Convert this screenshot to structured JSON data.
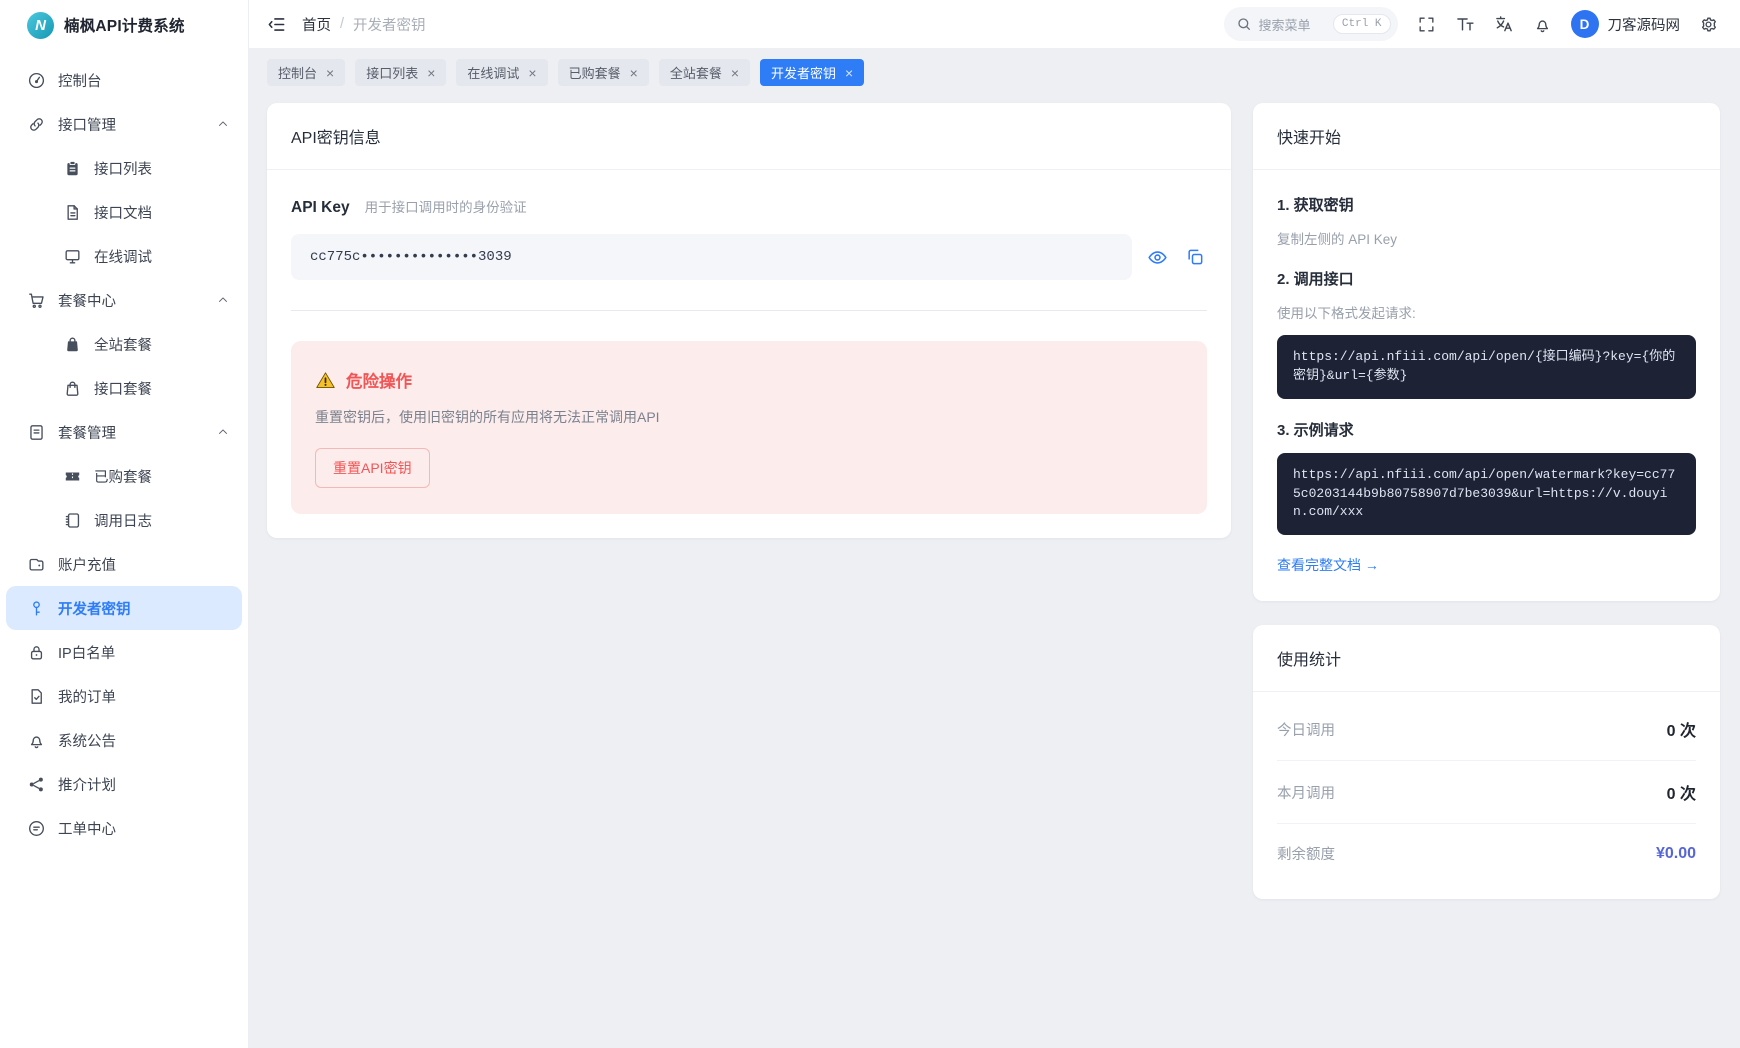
{
  "app": {
    "title": "楠枫API计费系统",
    "logo_letter": "N",
    "logo_icon": "logo-icon"
  },
  "colors": {
    "primary": "#2e7cf6",
    "sidebar_active_bg": "#dbeafe",
    "page_bg": "#edeff3",
    "danger_text": "#f25555",
    "danger_bg": "#fdecec",
    "code_bg": "#1d2335",
    "balance_value": "#5566d6",
    "avatar_bg": "#2e73f2"
  },
  "sidebar": {
    "items": [
      {
        "key": "dashboard",
        "label": "控制台",
        "icon": "dashboard-icon"
      },
      {
        "key": "api-management",
        "label": "接口管理",
        "icon": "api-link-icon",
        "expanded": true,
        "children": [
          {
            "key": "api-list",
            "label": "接口列表",
            "icon": "clipboard-icon"
          },
          {
            "key": "api-docs",
            "label": "接口文档",
            "icon": "file-text-icon"
          },
          {
            "key": "online-debug",
            "label": "在线调试",
            "icon": "monitor-icon"
          }
        ]
      },
      {
        "key": "package-center",
        "label": "套餐中心",
        "icon": "cart-icon",
        "expanded": true,
        "children": [
          {
            "key": "site-packages",
            "label": "全站套餐",
            "icon": "bag-filled-icon"
          },
          {
            "key": "api-packages",
            "label": "接口套餐",
            "icon": "bag-outline-icon"
          }
        ]
      },
      {
        "key": "package-management",
        "label": "套餐管理",
        "icon": "document-lines-icon",
        "expanded": true,
        "children": [
          {
            "key": "purchased-packages",
            "label": "已购套餐",
            "icon": "ticket-icon"
          },
          {
            "key": "call-logs",
            "label": "调用日志",
            "icon": "notebook-icon"
          }
        ]
      },
      {
        "key": "account-recharge",
        "label": "账户充值",
        "icon": "wallet-icon"
      },
      {
        "key": "developer-key",
        "label": "开发者密钥",
        "icon": "key-icon",
        "active": true
      },
      {
        "key": "ip-whitelist",
        "label": "IP白名单",
        "icon": "lock-icon"
      },
      {
        "key": "my-orders",
        "label": "我的订单",
        "icon": "file-check-icon"
      },
      {
        "key": "system-announcements",
        "label": "系统公告",
        "icon": "bell-icon"
      },
      {
        "key": "referral-program",
        "label": "推介计划",
        "icon": "share-icon"
      },
      {
        "key": "ticket-center",
        "label": "工单中心",
        "icon": "chat-circle-icon"
      }
    ]
  },
  "header": {
    "collapse_icon": "collapse-sidebar-icon",
    "breadcrumb": {
      "home": "首页",
      "separator": "/",
      "current": "开发者密钥"
    },
    "search": {
      "icon": "search-icon",
      "placeholder": "搜索菜单",
      "shortcut": "Ctrl K"
    },
    "tools": [
      {
        "key": "fullscreen",
        "icon": "fullscreen-icon"
      },
      {
        "key": "font-size",
        "icon": "font-size-icon"
      },
      {
        "key": "translate",
        "icon": "translate-icon"
      },
      {
        "key": "notifications",
        "icon": "bell-icon"
      }
    ],
    "user": {
      "initial": "D",
      "name": "刀客源码网"
    },
    "settings_icon": "gear-icon"
  },
  "tabs": [
    {
      "key": "dashboard",
      "label": "控制台"
    },
    {
      "key": "api-list",
      "label": "接口列表"
    },
    {
      "key": "online-debug",
      "label": "在线调试"
    },
    {
      "key": "purchased-packages",
      "label": "已购套餐"
    },
    {
      "key": "site-packages",
      "label": "全站套餐"
    },
    {
      "key": "developer-key",
      "label": "开发者密钥",
      "active": true
    }
  ],
  "tab_close_glyph": "×",
  "main": {
    "card_title": "API密钥信息",
    "api_key": {
      "label": "API Key",
      "hint": "用于接口调用时的身份验证",
      "value": "cc775c••••••••••••••3039",
      "actions": [
        "eye-icon",
        "copy-icon"
      ]
    },
    "danger": {
      "warning_icon": "warning-triangle-icon",
      "title": "危险操作",
      "desc": "重置密钥后，使用旧密钥的所有应用将无法正常调用API",
      "button": "重置API密钥"
    }
  },
  "quick_start": {
    "title": "快速开始",
    "steps": [
      {
        "title": "1. 获取密钥",
        "desc": "复制左侧的 API Key"
      },
      {
        "title": "2. 调用接口",
        "desc": "使用以下格式发起请求:",
        "code": "https://api.nfiii.com/api/open/{接口编码}?key={你的密钥}&url={参数}"
      },
      {
        "title": "3. 示例请求",
        "code": "https://api.nfiii.com/api/open/watermark?key=cc775c0203144b9b80758907d7be3039&url=https://v.douyin.com/xxx"
      }
    ],
    "doc_link": "查看完整文档 →"
  },
  "usage_stats": {
    "title": "使用统计",
    "rows": [
      {
        "label": "今日调用",
        "value": "0 次"
      },
      {
        "label": "本月调用",
        "value": "0 次"
      },
      {
        "label": "剩余额度",
        "value": "¥0.00",
        "highlight": true
      }
    ]
  }
}
